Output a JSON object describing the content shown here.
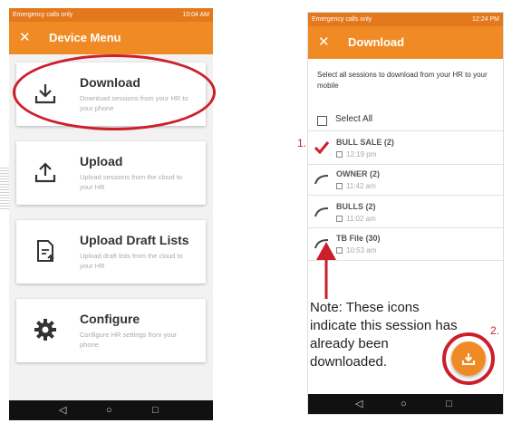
{
  "left": {
    "status_left": "Emergency calls only",
    "status_right": "10:04 AM",
    "title": "Device Menu",
    "cards": [
      {
        "title": "Download",
        "desc": "Download sessions from your HR to your phone"
      },
      {
        "title": "Upload",
        "desc": "Upload sessions from the cloud to your HR"
      },
      {
        "title": "Upload Draft Lists",
        "desc": "Upload draft lists from the cloud to your HR"
      },
      {
        "title": "Configure",
        "desc": "Configure HR settings from your phone"
      }
    ],
    "nav": {
      "back": "◁",
      "home": "○",
      "recent": "□"
    }
  },
  "right": {
    "status_left": "Emergency calls only",
    "status_right": "12:24 PM",
    "title": "Download",
    "instruction": "Select all sessions to download from your HR to your mobile",
    "select_all": "Select All",
    "sessions": [
      {
        "name": "BULL SALE (2)",
        "time": "12:19 pm"
      },
      {
        "name": "OWNER (2)",
        "time": "11:42 am"
      },
      {
        "name": "BULLS (2)",
        "time": "11:02 am"
      },
      {
        "name": "TB File (30)",
        "time": "10:53 am"
      }
    ],
    "nav": {
      "back": "◁",
      "home": "○",
      "recent": "□"
    }
  },
  "annotations": {
    "note": "Note: These icons indicate this session has already been downloaded.",
    "num1": "1.",
    "num2": "2."
  },
  "colors": {
    "accent": "#f08a24",
    "statusbar": "#e4781c",
    "annotation_red": "#cc1f2a"
  }
}
